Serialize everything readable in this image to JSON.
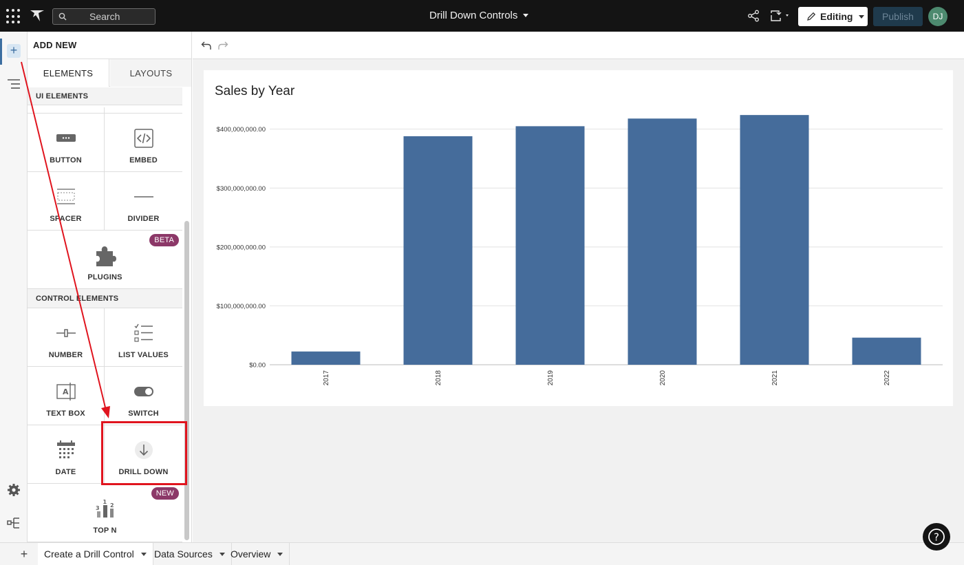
{
  "topbar": {
    "search_placeholder": "Search",
    "document_title": "Drill Down Controls",
    "editing_label": "Editing",
    "publish_label": "Publish",
    "avatar_initials": "DJ"
  },
  "panel": {
    "title": "ADD NEW",
    "tabs": [
      "ELEMENTS",
      "LAYOUTS"
    ],
    "ui_section_label": "UI ELEMENTS",
    "control_section_label": "CONTROL ELEMENTS",
    "ui_tiles": {
      "button": "BUTTON",
      "embed": "EMBED",
      "spacer": "SPACER",
      "divider": "DIVIDER",
      "plugins": "PLUGINS",
      "plugins_badge": "BETA"
    },
    "control_tiles": {
      "number": "NUMBER",
      "list_values": "LIST VALUES",
      "text_box": "TEXT BOX",
      "switch": "SWITCH",
      "date": "DATE",
      "drill_down": "DRILL DOWN",
      "top_n": "TOP N",
      "top_n_badge": "NEW"
    }
  },
  "chart": {
    "title": "Sales by Year"
  },
  "chart_data": {
    "type": "bar",
    "title": "Sales by Year",
    "categories": [
      "2017",
      "2018",
      "2019",
      "2020",
      "2021",
      "2022"
    ],
    "values": [
      22500000,
      388000000,
      405000000,
      418000000,
      424000000,
      46000000
    ],
    "ylim": [
      0,
      430000000
    ],
    "yticks": [
      0,
      100000000,
      200000000,
      300000000,
      400000000
    ],
    "ytick_labels": [
      "$0.00",
      "$100,000,000.00",
      "$200,000,000.00",
      "$300,000,000.00",
      "$400,000,000.00"
    ],
    "bar_color": "#456c9b",
    "grid": true
  },
  "pages": [
    {
      "label": "Create a Drill Control",
      "active": true
    },
    {
      "label": "Data Sources",
      "active": false
    },
    {
      "label": "Overview",
      "active": false
    }
  ],
  "help_label": "?",
  "colors": {
    "accent": "#3c6ea0",
    "badge": "#8c3868",
    "annotation": "#e0141e"
  }
}
